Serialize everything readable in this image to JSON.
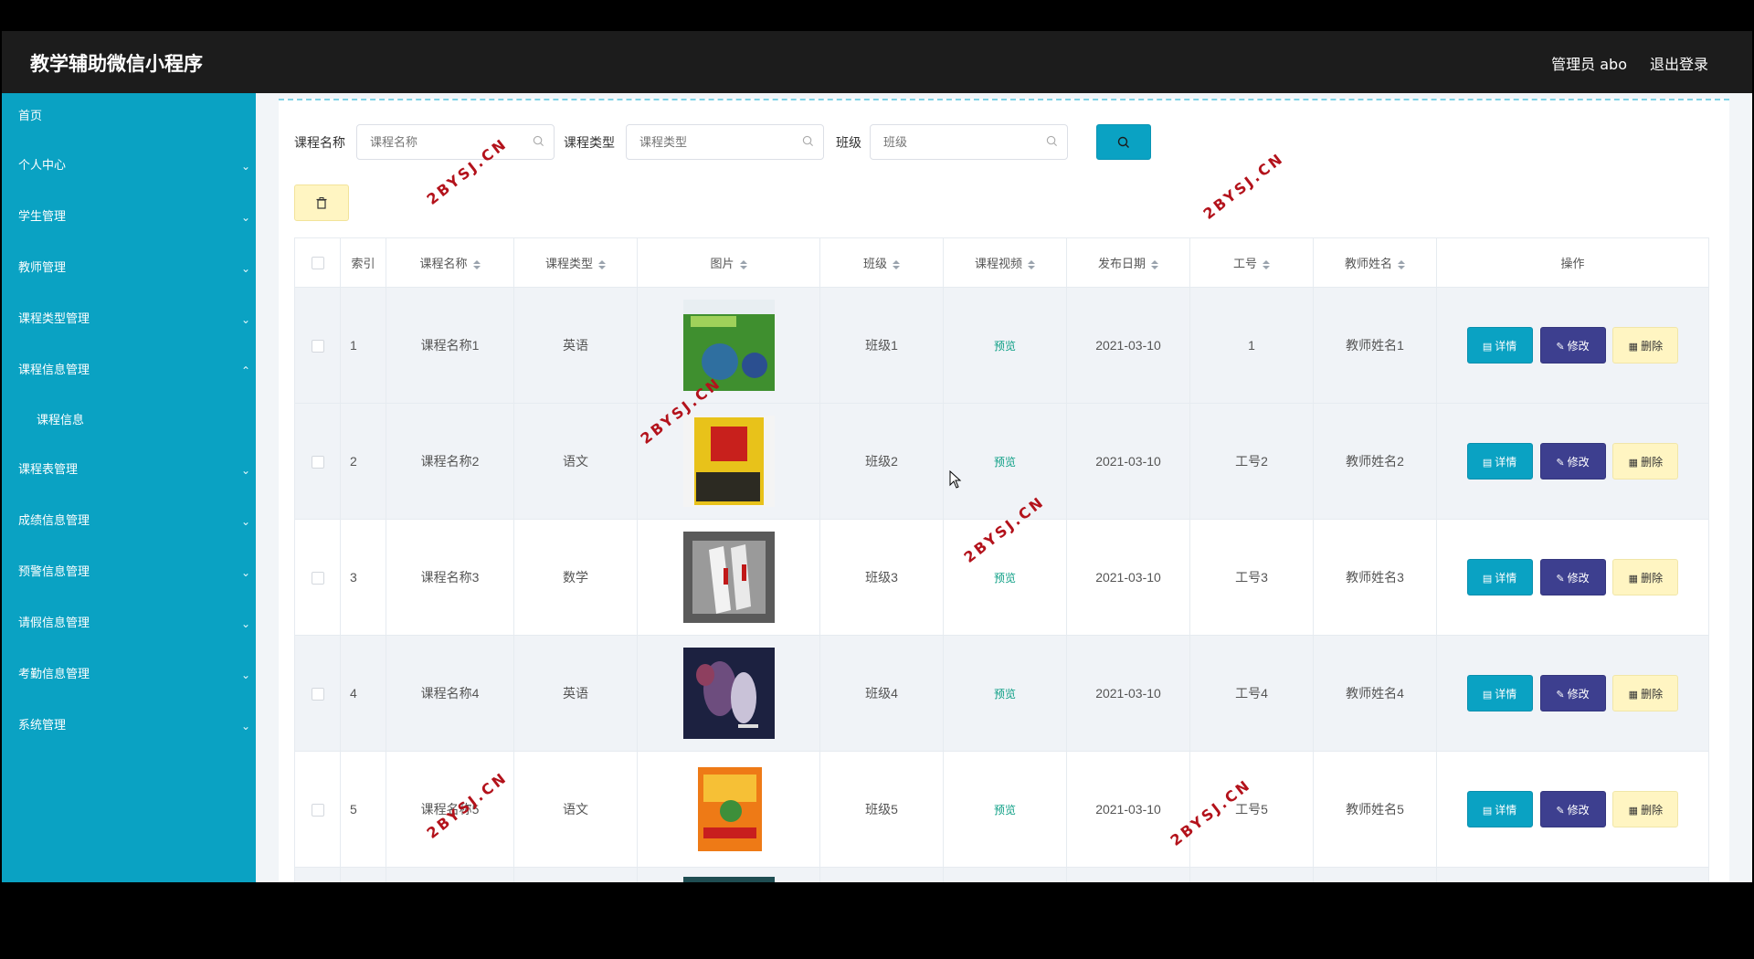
{
  "header": {
    "app_title": "教学辅助微信小程序",
    "admin_label": "管理员 abo",
    "logout_label": "退出登录"
  },
  "sidebar": {
    "items": [
      {
        "label": "首页",
        "expandable": false
      },
      {
        "label": "个人中心",
        "expandable": true
      },
      {
        "label": "学生管理",
        "expandable": true
      },
      {
        "label": "教师管理",
        "expandable": true
      },
      {
        "label": "课程类型管理",
        "expandable": true
      },
      {
        "label": "课程信息管理",
        "expandable": true,
        "expanded": true
      },
      {
        "label": "课程表管理",
        "expandable": true
      },
      {
        "label": "成绩信息管理",
        "expandable": true
      },
      {
        "label": "预警信息管理",
        "expandable": true
      },
      {
        "label": "请假信息管理",
        "expandable": true
      },
      {
        "label": "考勤信息管理",
        "expandable": true
      },
      {
        "label": "系统管理",
        "expandable": true
      }
    ],
    "submenu": {
      "label": "课程信息"
    }
  },
  "search": {
    "course_name_label": "课程名称",
    "course_name_placeholder": "课程名称",
    "course_type_label": "课程类型",
    "course_type_placeholder": "课程类型",
    "class_label": "班级",
    "class_placeholder": "班级"
  },
  "table": {
    "headers": [
      "索引",
      "课程名称",
      "课程类型",
      "图片",
      "班级",
      "课程视频",
      "发布日期",
      "工号",
      "教师姓名",
      "操作"
    ],
    "rows": [
      {
        "index": "1",
        "name": "课程名称1",
        "type": "英语",
        "class": "班级1",
        "video": "预览",
        "date": "2021-03-10",
        "job_no": "1",
        "teacher": "教师姓名1"
      },
      {
        "index": "2",
        "name": "课程名称2",
        "type": "语文",
        "class": "班级2",
        "video": "预览",
        "date": "2021-03-10",
        "job_no": "工号2",
        "teacher": "教师姓名2"
      },
      {
        "index": "3",
        "name": "课程名称3",
        "type": "数学",
        "class": "班级3",
        "video": "预览",
        "date": "2021-03-10",
        "job_no": "工号3",
        "teacher": "教师姓名3"
      },
      {
        "index": "4",
        "name": "课程名称4",
        "type": "英语",
        "class": "班级4",
        "video": "预览",
        "date": "2021-03-10",
        "job_no": "工号4",
        "teacher": "教师姓名4"
      },
      {
        "index": "5",
        "name": "课程名称5",
        "type": "语文",
        "class": "班级5",
        "video": "预览",
        "date": "2021-03-10",
        "job_no": "工号5",
        "teacher": "教师姓名5"
      }
    ],
    "actions": {
      "detail": "详情",
      "edit": "修改",
      "delete": "删除"
    }
  },
  "watermark": "2BYSJ.CN",
  "colors": {
    "topbar": "#1c1c1c",
    "sidebar": "#0aa2c3",
    "accent": "#0aa2c3",
    "edit_button": "#3d3f8f",
    "delete_button": "#fff5c2",
    "preview_link": "#0b9e84"
  }
}
